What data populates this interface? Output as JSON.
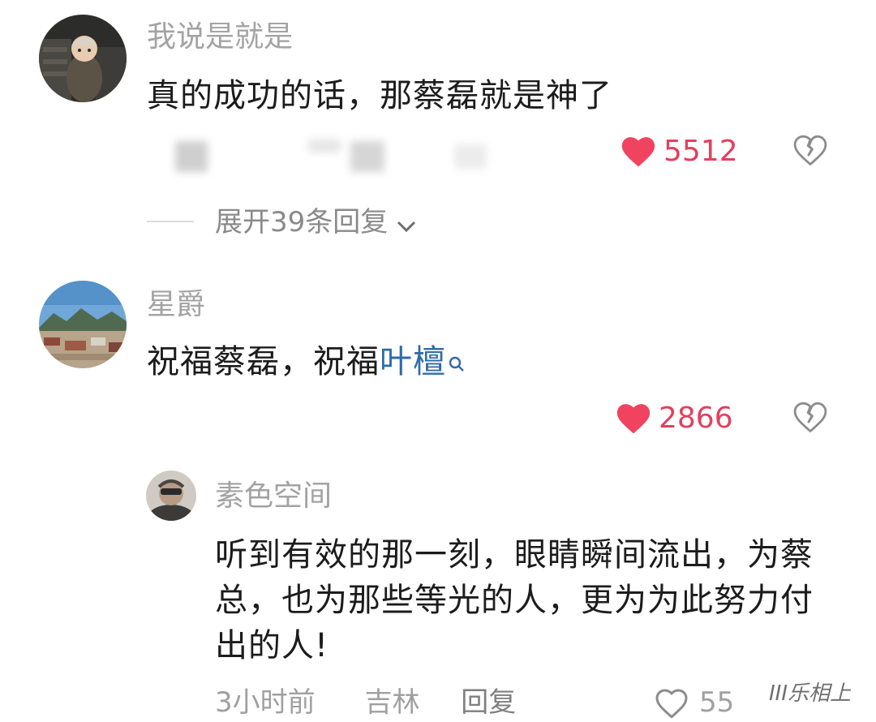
{
  "comments": [
    {
      "username": "我说是就是",
      "content": "真的成功的话，那蔡磊就是神了",
      "likes": "5512",
      "expand_replies": "展开39条回复"
    },
    {
      "username": "星爵",
      "content_prefix": "祝福蔡磊，祝福",
      "content_link": "叶檀",
      "likes": "2866",
      "reply": {
        "username": "素色空间",
        "content": "听到有效的那一刻，眼睛瞬间流出，为蔡总，也为那些等光的人，更为为此努力付出的人!",
        "meta_time": "3小时前",
        "meta_location": "吉林",
        "meta_reply": "回复",
        "likes": "55"
      }
    }
  ],
  "watermark": "III乐相上",
  "colors": {
    "like_red": "#f0435f",
    "username_gray": "#a3a3a3",
    "link_blue": "#2f6ba8"
  },
  "icons": [
    "heart-filled-icon",
    "broken-heart-icon",
    "chevron-down-icon",
    "search-icon",
    "heart-outline-icon"
  ]
}
